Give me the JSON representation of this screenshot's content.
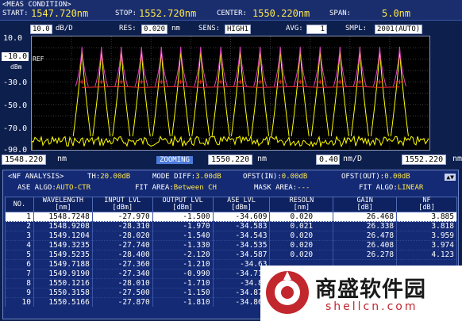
{
  "header": {
    "title": "<MEAS CONDITION>",
    "start_label": "START:",
    "start_value": "1547.720nm",
    "stop_label": "STOP:",
    "stop_value": "1552.720nm",
    "center_label": "CENTER:",
    "center_value": "1550.220nm",
    "span_label": "SPAN:",
    "span_value": "5.0nm"
  },
  "controls": {
    "scale_value": "10.0",
    "scale_unit": "dB/D",
    "res_label": "RES:",
    "res_value": "0.020",
    "res_unit": "nm",
    "sens_label": "SENS:",
    "sens_value": "HIGH1",
    "avg_label": "AVG:",
    "avg_value": "1",
    "smpl_label": "SMPL:",
    "smpl_value": "2001(AUTO)"
  },
  "yaxis": {
    "ticks": [
      "10.0",
      "-10.0",
      "-30.0",
      "-50.0",
      "-70.0",
      "-90.0"
    ],
    "ref_label": "REF",
    "unit": "dBm"
  },
  "xaxis": {
    "left": "1548.220",
    "left_unit": "nm",
    "zoom": "ZOOMING",
    "center": "1550.220",
    "center_unit": "nm",
    "div": "0.40",
    "div_unit": "nm/D",
    "right": "1552.220",
    "right_unit": "nm"
  },
  "chart_data": {
    "type": "line",
    "xlim": [
      1548.22,
      1552.22
    ],
    "ylim": [
      -90,
      10
    ],
    "peak_wavelengths": [
      1548.7248,
      1548.9208,
      1549.1204,
      1549.3235,
      1549.5235,
      1549.7188,
      1549.919,
      1550.1216,
      1550.3158,
      1550.5166,
      1550.72,
      1550.92,
      1551.12,
      1551.32,
      1551.52,
      1551.72,
      1551.92
    ],
    "colors": {
      "magenta": "#e040c0",
      "yellow": "#ffff00",
      "red": "#ff3030"
    }
  },
  "nf_panel": {
    "title": "<NF ANALYSIS>",
    "th_label": "TH:",
    "th_value": "20.00dB",
    "mode_label": "MODE DIFF:",
    "mode_value": "3.00dB",
    "ofst_in_label": "OFST(IN):",
    "ofst_in_value": "0.00dB",
    "ofst_out_label": "OFST(OUT):",
    "ofst_out_value": "0.00dB",
    "ase_label": "ASE ALGO:",
    "ase_value": "AUTO-CTR",
    "fit_area_label": "FIT AREA:",
    "fit_area_value": "Between CH",
    "mask_label": "MASK AREA:",
    "mask_value": "---",
    "fit_algo_label": "FIT ALGO:",
    "fit_algo_value": "LINEAR",
    "nav": "▲▼"
  },
  "table": {
    "headers": [
      {
        "l1": "NO.",
        "l2": ""
      },
      {
        "l1": "WAVELENGTH",
        "l2": "[nm]"
      },
      {
        "l1": "INPUT LVL",
        "l2": "[dBm]"
      },
      {
        "l1": "OUTPUT LVL",
        "l2": "[dBm]"
      },
      {
        "l1": "ASE LVL",
        "l2": "[dBm]"
      },
      {
        "l1": "RESOLN",
        "l2": "[nm]"
      },
      {
        "l1": "GAIN",
        "l2": "[dB]"
      },
      {
        "l1": "NF",
        "l2": "[dB]"
      }
    ],
    "rows": [
      [
        "1",
        "1548.7248",
        "-27.970",
        "-1.500",
        "-34.609",
        "0.020",
        "26.468",
        "3.885"
      ],
      [
        "2",
        "1548.9208",
        "-28.310",
        "-1.970",
        "-34.583",
        "0.021",
        "26.338",
        "3.818"
      ],
      [
        "3",
        "1549.1204",
        "-28.020",
        "-1.540",
        "-34.543",
        "0.020",
        "26.478",
        "3.959"
      ],
      [
        "4",
        "1549.3235",
        "-27.740",
        "-1.330",
        "-34.535",
        "0.020",
        "26.408",
        "3.974"
      ],
      [
        "5",
        "1549.5235",
        "-28.400",
        "-2.120",
        "-34.587",
        "0.020",
        "26.278",
        "4.123"
      ],
      [
        "6",
        "1549.7188",
        "-27.360",
        "-1.210",
        "-34.63",
        "",
        "",
        ""
      ],
      [
        "7",
        "1549.9190",
        "-27.340",
        "-0.990",
        "-34.714",
        "",
        "",
        ""
      ],
      [
        "8",
        "1550.1216",
        "-28.010",
        "-1.710",
        "-34.83",
        "",
        "",
        ""
      ],
      [
        "9",
        "1550.3158",
        "-27.500",
        "-1.150",
        "-34.879",
        "",
        "",
        ""
      ],
      [
        "10",
        "1550.5166",
        "-27.870",
        "-1.810",
        "-34.860",
        "",
        "",
        ""
      ]
    ]
  },
  "watermark": {
    "text": "商盛软件园",
    "url": "shellcn.com"
  }
}
